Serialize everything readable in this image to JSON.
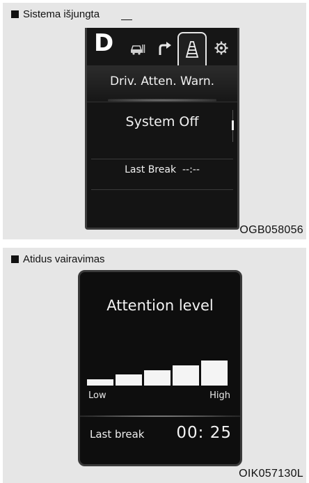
{
  "top_panel": {
    "caption": "Sistema išjungta",
    "code": "OGB058056",
    "screen": {
      "gear": "D",
      "tabs": [
        {
          "icon": "car-distance-icon"
        },
        {
          "icon": "turn-arrow-icon"
        },
        {
          "icon": "lane-road-icon",
          "selected": true
        },
        {
          "icon": "gear-icon"
        }
      ],
      "menu_title": "Driv. Atten. Warn.",
      "status": "System Off",
      "last_break": "Last Break  --:--"
    }
  },
  "bottom_panel": {
    "caption": "Atidus vairavimas",
    "code": "OIK057130L",
    "screen": {
      "title": "Attention level",
      "level": {
        "value": 5,
        "max": 5
      },
      "low_label": "Low",
      "high_label": "High",
      "last_break_label": "Last break",
      "last_break_time": "00: 25"
    }
  },
  "colors": {
    "panel_bg": "#e6e6e6",
    "screen_bg": "#141414",
    "text_light": "#f1f1f1"
  }
}
